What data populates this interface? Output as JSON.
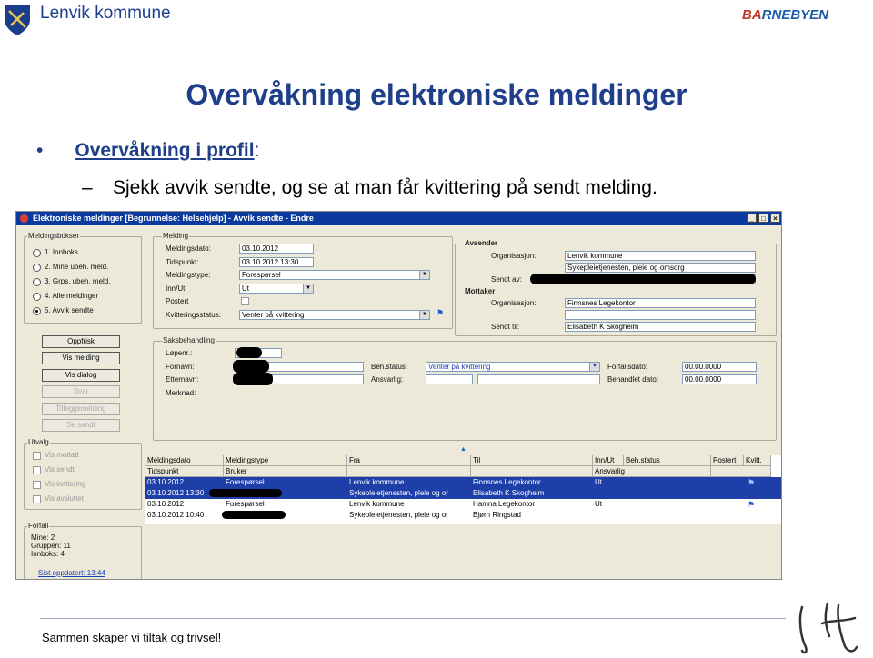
{
  "header": {
    "org_name": "Lenvik kommune",
    "brand_part1": "BA",
    "brand_part2": "RNEBYEN",
    "shield_color": "#1a3e8c"
  },
  "slide": {
    "title": "Overvåkning elektroniske meldinger",
    "bullet1_main": "Overvåkning i profil",
    "bullet1_colon": ":",
    "bullet2": "Sjekk avvik sendte, og se at man får kvittering på sendt melding."
  },
  "footer": {
    "text": "Sammen skaper vi tiltak og trivsel!"
  },
  "window": {
    "title": "Elektroniske meldinger [Begrunnelse: Helsehjelp] - Avvik sendte - Endre",
    "meldingsbokser": {
      "title": "Meldingsbokser",
      "items": [
        "1. Innboks",
        "2. Mine ubeh. meld.",
        "3. Grps. ubeh. meld.",
        "4. Alle meldinger",
        "5. Avvik sendte"
      ],
      "selected_index": 4
    },
    "buttons": [
      {
        "label": "Oppfrisk",
        "enabled": true
      },
      {
        "label": "Vis melding",
        "enabled": true
      },
      {
        "label": "Vis dialog",
        "enabled": true
      },
      {
        "label": "Svar",
        "enabled": false
      },
      {
        "label": "Tilleggsmelding",
        "enabled": false
      },
      {
        "label": "Se sendt",
        "enabled": false
      }
    ],
    "utvalg": {
      "title": "Utvalg",
      "items": [
        "Vis mottatt",
        "Vis sendt",
        "Vis kvittering",
        "Vis avsluttet"
      ]
    },
    "forfall": {
      "title": "Forfall",
      "lines": [
        "Mine: 2",
        "Gruppen: 11",
        "Innboks: 4"
      ],
      "link": "Sist oppdatert: 13:44"
    },
    "melding": {
      "title": "Melding",
      "meldingsdato_label": "Meldingsdato:",
      "meldingsdato": "03.10.2012",
      "tidspunkt_label": "Tidspunkt:",
      "tidspunkt": "03.10.2012 13:30",
      "meldingstype_label": "Meldingstype:",
      "meldingstype": "Forespørsel",
      "innut_label": "Inn/Ut:",
      "innut": "Ut",
      "postert_label": "Postert",
      "kvittering_label": "Kvitteringsstatus:",
      "kvittering": "Venter på kvittering"
    },
    "avsender": {
      "title": "Avsender",
      "org_label": "Organisasjon:",
      "org1": "Lenvik kommune",
      "org2": "Sykepleietjenesten, pleie og omsorg",
      "sendt_av_label": "Sendt av:"
    },
    "mottaker": {
      "title": "Mottaker",
      "org_label": "Organisasjon:",
      "org": "Finnsnes Legekontor",
      "sendt_til_label": "Sendt til:",
      "sendt_til": "Elisabeth K Skogheim"
    },
    "saksbehandling": {
      "title": "Saksbehandling",
      "lopenr_label": "Løpenr.:",
      "fornavn_label": "Fornavn:",
      "etternavn_label": "Etternavn:",
      "merknad_label": "Merknad:",
      "behstatus_label": "Beh.status:",
      "behstatus": "Venter på kvittering",
      "ansvarlig_label": "Ansvarlig:",
      "forfallsdato_label": "Forfallsdato:",
      "forfallsdato": "00.00.0000",
      "behandlet_label": "Behandlet dato:",
      "behandlet": "00.00.0000"
    },
    "grid": {
      "headers_row1": [
        "Meldingsdato",
        "Meldingstype",
        "Fra",
        "Til",
        "Inn/Ut",
        "Beh.status",
        "Postert",
        "Kvitt."
      ],
      "headers_row2": [
        "Tidspunkt",
        "Bruker",
        "",
        "",
        "Ansvarlig",
        "",
        "",
        ""
      ],
      "rows": [
        {
          "c1": "03.10.2012",
          "c2": "Forespørsel",
          "c3": "Lenvik kommune",
          "c4": "Finnsnes Legekontor",
          "c5": "Ut",
          "selected": true
        },
        {
          "c1": "03.10.2012 13:30",
          "c2": "",
          "c3": "Sykepleietjenesten, pleie og or",
          "c4": "Elisabeth K Skogheim",
          "c5": "",
          "selected": true
        },
        {
          "c1": "03.10.2012",
          "c2": "Forespørsel",
          "c3": "Lenvik kommune",
          "c4": "Hamna Legekontor",
          "c5": "Ut",
          "selected": false
        },
        {
          "c1": "03.10.2012 10:40",
          "c2": "",
          "c3": "Sykepleietjenesten, pleie og or",
          "c4": "Bjørn Ringstad",
          "c5": "",
          "selected": false
        }
      ]
    }
  }
}
